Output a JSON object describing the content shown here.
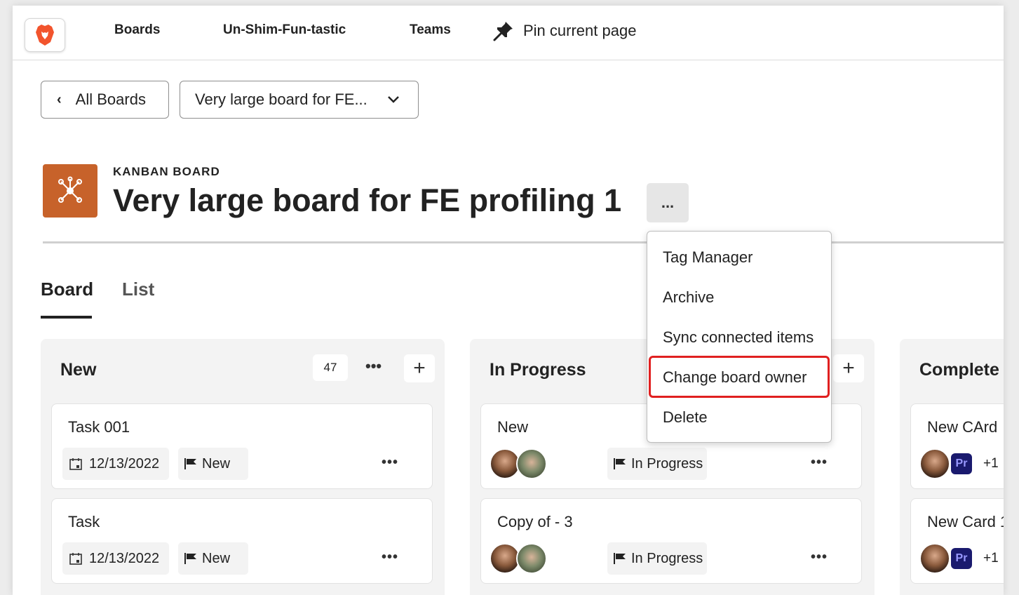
{
  "nav": {
    "links": [
      "Boards",
      "Un-Shim-Fun-tastic",
      "Teams"
    ],
    "pin_label": "Pin current page"
  },
  "breadcrumb": {
    "back_label": "All Boards",
    "board_select": "Very large board for FE..."
  },
  "board": {
    "type_label": "KANBAN BOARD",
    "title": "Very large board for FE profiling 1",
    "more_label": "..."
  },
  "tabs": [
    "Board",
    "List"
  ],
  "menu": {
    "items": [
      "Tag Manager",
      "Archive",
      "Sync connected items",
      "Change board owner",
      "Delete"
    ]
  },
  "columns": [
    {
      "title": "New",
      "count": "47",
      "cards": [
        {
          "title": "Task 001",
          "date": "12/13/2022",
          "status": "New"
        },
        {
          "title": "Task",
          "date": "12/13/2022",
          "status": "New"
        }
      ]
    },
    {
      "title": "In Progress",
      "cards": [
        {
          "title": "New",
          "status": "In Progress"
        },
        {
          "title": "Copy of - 3",
          "status": "In Progress"
        }
      ]
    },
    {
      "title": "Complete",
      "cards": [
        {
          "title": "New CArd",
          "extra": "+1",
          "app_badge": "Pr"
        },
        {
          "title": "New Card 1",
          "extra": "+1",
          "app_badge": "Pr"
        }
      ]
    }
  ],
  "colors": {
    "board_icon": "#c7622a",
    "highlight": "#e02020",
    "pr_badge": "#1a1a6e"
  }
}
